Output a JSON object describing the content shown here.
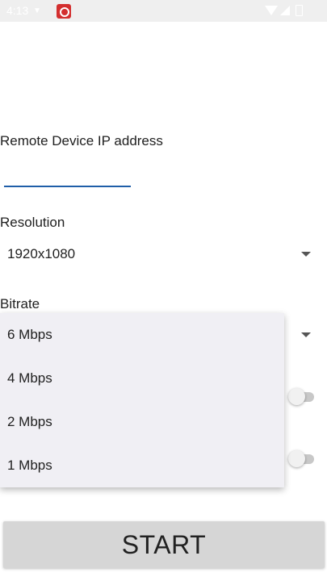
{
  "status_bar": {
    "time": "4:13",
    "icons": [
      "download-icon",
      "app-notification-icon",
      "wifi-icon",
      "signal-icon",
      "battery-icon"
    ]
  },
  "form": {
    "ip_label": "Remote Device IP address",
    "ip_value": "",
    "resolution_label": "Resolution",
    "resolution_value": "1920x1080",
    "bitrate_label": "Bitrate",
    "bitrate_options": [
      "6 Mbps",
      "4 Mbps",
      "2 Mbps",
      "1 Mbps"
    ],
    "switch_1_on": false,
    "switch_2_on": false
  },
  "start_button": {
    "label": "START"
  },
  "colors": {
    "accent": "#1f5ea8",
    "dropdown_bg": "#f0eff4",
    "button_bg": "#d6d6d6"
  }
}
